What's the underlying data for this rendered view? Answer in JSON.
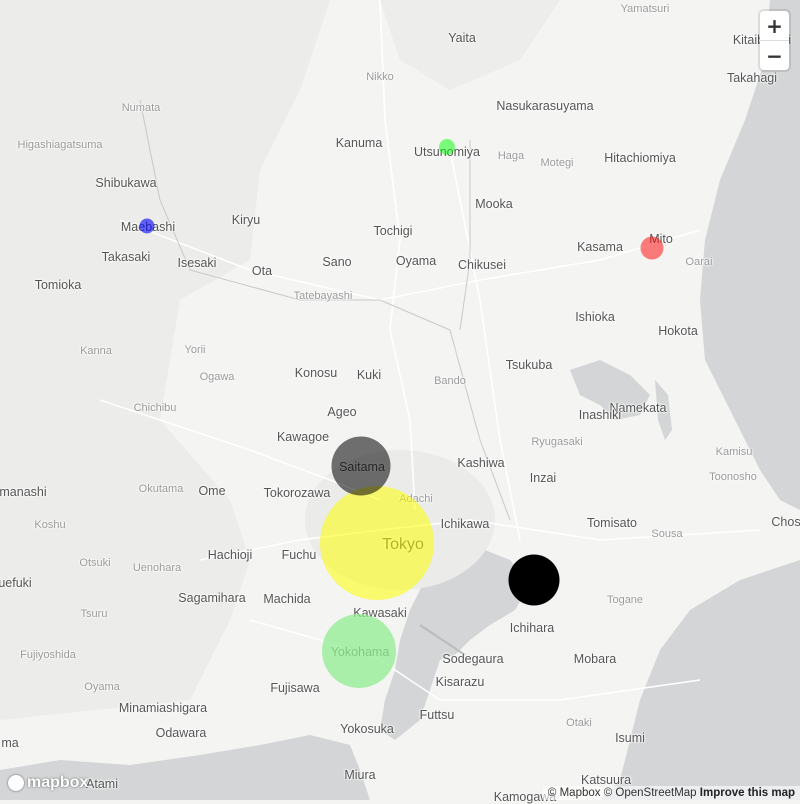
{
  "map": {
    "place_labels": [
      {
        "text": "Yamatsuri",
        "type": "minor"
      },
      {
        "text": "Yaita",
        "type": "city"
      },
      {
        "text": "Kitaibaraki",
        "type": "city"
      },
      {
        "text": "Takahagi",
        "type": "city"
      },
      {
        "text": "Nikko",
        "type": "minor"
      },
      {
        "text": "Numata",
        "type": "minor"
      },
      {
        "text": "Nasukarasuyama",
        "type": "city"
      },
      {
        "text": "Higashiagatsuma",
        "type": "minor"
      },
      {
        "text": "Kanuma",
        "type": "city"
      },
      {
        "text": "Utsunomiya",
        "type": "city"
      },
      {
        "text": "Haga",
        "type": "minor"
      },
      {
        "text": "Motegi",
        "type": "minor"
      },
      {
        "text": "Hitachiomiya",
        "type": "city"
      },
      {
        "text": "Shibukawa",
        "type": "city"
      },
      {
        "text": "Mooka",
        "type": "city"
      },
      {
        "text": "Maebashi",
        "type": "city"
      },
      {
        "text": "Kiryu",
        "type": "city"
      },
      {
        "text": "Tochigi",
        "type": "city"
      },
      {
        "text": "Kasama",
        "type": "city"
      },
      {
        "text": "Mito",
        "type": "city"
      },
      {
        "text": "Takasaki",
        "type": "city"
      },
      {
        "text": "Isesaki",
        "type": "city"
      },
      {
        "text": "Ota",
        "type": "city"
      },
      {
        "text": "Sano",
        "type": "city"
      },
      {
        "text": "Oyama",
        "type": "city"
      },
      {
        "text": "Chikusei",
        "type": "city"
      },
      {
        "text": "Oarai",
        "type": "minor"
      },
      {
        "text": "Tomioka",
        "type": "city"
      },
      {
        "text": "Tatebayashi",
        "type": "minor"
      },
      {
        "text": "Ishioka",
        "type": "city"
      },
      {
        "text": "Hokota",
        "type": "city"
      },
      {
        "text": "Kanna",
        "type": "minor"
      },
      {
        "text": "Yorii",
        "type": "minor"
      },
      {
        "text": "Konosu",
        "type": "city"
      },
      {
        "text": "Kuki",
        "type": "city"
      },
      {
        "text": "Tsukuba",
        "type": "city"
      },
      {
        "text": "Ogawa",
        "type": "minor"
      },
      {
        "text": "Bando",
        "type": "minor"
      },
      {
        "text": "Chichibu",
        "type": "minor"
      },
      {
        "text": "Ageo",
        "type": "city"
      },
      {
        "text": "Namekata",
        "type": "city"
      },
      {
        "text": "Inashiki",
        "type": "city"
      },
      {
        "text": "Kawagoe",
        "type": "city"
      },
      {
        "text": "Ryugasaki",
        "type": "minor"
      },
      {
        "text": "Kamisu",
        "type": "minor"
      },
      {
        "text": "Saitama",
        "type": "city"
      },
      {
        "text": "Kashiwa",
        "type": "city"
      },
      {
        "text": "manashi",
        "type": "city"
      },
      {
        "text": "Okutama",
        "type": "minor"
      },
      {
        "text": "Ome",
        "type": "city"
      },
      {
        "text": "Tokorozawa",
        "type": "city"
      },
      {
        "text": "Inzai",
        "type": "city"
      },
      {
        "text": "Toonosho",
        "type": "minor"
      },
      {
        "text": "Adachi",
        "type": "minor"
      },
      {
        "text": "Koshu",
        "type": "minor"
      },
      {
        "text": "Ichikawa",
        "type": "city"
      },
      {
        "text": "Tomisato",
        "type": "city"
      },
      {
        "text": "Chos",
        "type": "city"
      },
      {
        "text": "Hachioji",
        "type": "city"
      },
      {
        "text": "Fuchu",
        "type": "city"
      },
      {
        "text": "Tokyo",
        "type": "big"
      },
      {
        "text": "Sousa",
        "type": "minor"
      },
      {
        "text": "uefuki",
        "type": "city"
      },
      {
        "text": "Otsuki",
        "type": "minor"
      },
      {
        "text": "Uenohara",
        "type": "minor"
      },
      {
        "text": "Sagamihara",
        "type": "city"
      },
      {
        "text": "Machida",
        "type": "city"
      },
      {
        "text": "Tsuru",
        "type": "minor"
      },
      {
        "text": "Togane",
        "type": "minor"
      },
      {
        "text": "Kawasaki",
        "type": "city"
      },
      {
        "text": "Ichihara",
        "type": "city"
      },
      {
        "text": "Fujiyoshida",
        "type": "minor"
      },
      {
        "text": "Yokohama",
        "type": "city"
      },
      {
        "text": "Sodegaura",
        "type": "city"
      },
      {
        "text": "Mobara",
        "type": "city"
      },
      {
        "text": "Oyama",
        "type": "minor"
      },
      {
        "text": "Fujisawa",
        "type": "city"
      },
      {
        "text": "Kisarazu",
        "type": "city"
      },
      {
        "text": "Minamiashigara",
        "type": "city"
      },
      {
        "text": "Futtsu",
        "type": "city"
      },
      {
        "text": "Otaki",
        "type": "minor"
      },
      {
        "text": "Yokosuka",
        "type": "city"
      },
      {
        "text": "Odawara",
        "type": "city"
      },
      {
        "text": "Isumi",
        "type": "city"
      },
      {
        "text": "ma",
        "type": "city"
      },
      {
        "text": "Miura",
        "type": "city"
      },
      {
        "text": "Atami",
        "type": "city"
      },
      {
        "text": "Katsuura",
        "type": "city"
      },
      {
        "text": "Kamogawa",
        "type": "city"
      }
    ],
    "markers": [
      {
        "name": "tokyo-marker",
        "color": "#ffff00",
        "opacity": 0.55,
        "radius": "large"
      },
      {
        "name": "saitama-marker",
        "color": "#000000",
        "opacity": 0.55,
        "radius": "medium"
      },
      {
        "name": "yokohama-marker",
        "color": "#90ee90",
        "opacity": 0.75,
        "radius": "medium"
      },
      {
        "name": "chiba-marker",
        "color": "#000000",
        "opacity": 1,
        "radius": "medium-small"
      },
      {
        "name": "mito-marker",
        "color": "#ff0000",
        "opacity": 0.5,
        "radius": "small"
      },
      {
        "name": "utsunomiya-marker",
        "color": "#00ff00",
        "opacity": 0.5,
        "radius": "small"
      },
      {
        "name": "maebashi-marker",
        "color": "#0000ff",
        "opacity": 0.6,
        "radius": "small"
      }
    ]
  },
  "controls": {
    "zoom_in": "+",
    "zoom_out": "−"
  },
  "logo": {
    "text": "mapbox"
  },
  "attribution": {
    "mapbox": "© Mapbox",
    "osm": "© OpenStreetMap",
    "improve": "Improve this map"
  }
}
